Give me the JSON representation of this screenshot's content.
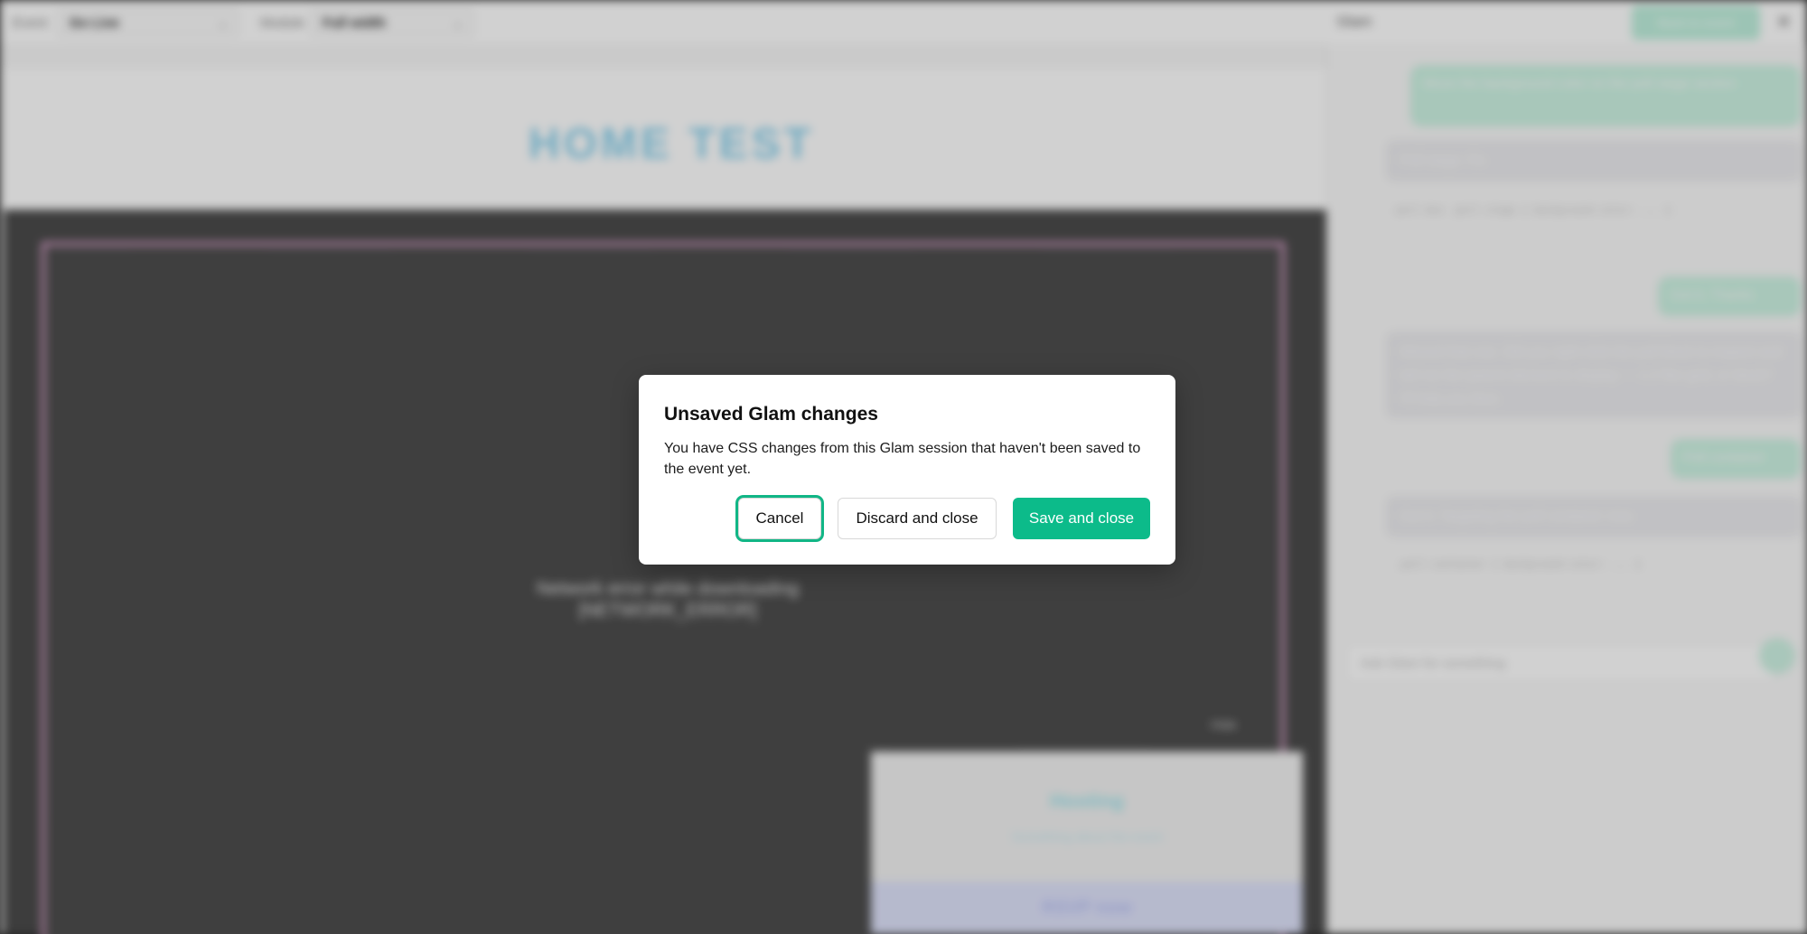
{
  "colors": {
    "accent": "#0cbb8a",
    "focus_ring": "#11b686",
    "overlay": "rgba(0,0,0,0.18)"
  },
  "background": {
    "topbar": {
      "event_label": "Event",
      "event_value": "Go Live",
      "mode_label": "Module",
      "mode_value": "Full width",
      "glam_title": "Glam",
      "back_button": "Back to event",
      "close_icon": "close-icon"
    },
    "preview": {
      "title": "HOME TEST",
      "error_line1": "Network error while downloading",
      "error_line2": "[NETWORK_ERROR]",
      "hide_label": "Hide",
      "card_title": "Hosting",
      "card_subtitle": "Something about the event",
      "card_button": "RSVP now"
    },
    "chat": {
      "msg1": "Move the background color on the poll stage section",
      "ai1": "Poll stage: Fix",
      "user2": "Got it, Thanks",
      "ai2": "Missed that one. Did you right-click the poll block to inspect and tell me the parent element to display — 1-2 flex grid, or block? I'll help you then.",
      "user3": "Poll container",
      "ai3": "Got it. Targeting the poll container now.",
      "input_placeholder": "Ask Glam for something"
    }
  },
  "modal": {
    "title": "Unsaved Glam changes",
    "body": "You have CSS changes from this Glam session that haven't been saved to the event yet.",
    "cancel_label": "Cancel",
    "discard_label": "Discard and close",
    "save_label": "Save and close"
  }
}
